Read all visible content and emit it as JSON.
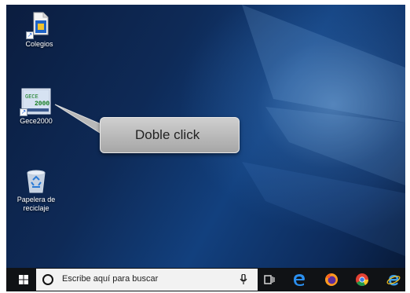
{
  "desktop": {
    "icons": [
      {
        "label": "Colegios"
      },
      {
        "label": "Gece2000",
        "badge_text": "Gece2000"
      },
      {
        "label": "Papelera de reciclaje"
      }
    ]
  },
  "callout": {
    "text": "Doble click"
  },
  "taskbar": {
    "search_placeholder": "Escribe aquí para buscar",
    "pinned": [
      "task-view-icon",
      "edge-icon",
      "firefox-icon",
      "chrome-icon",
      "internet-explorer-icon"
    ]
  },
  "colors": {
    "taskbar": "#101215",
    "callout": "#b5b5b5",
    "desktop_dark": "#0b1d3f",
    "desktop_light": "#7aaee6"
  }
}
